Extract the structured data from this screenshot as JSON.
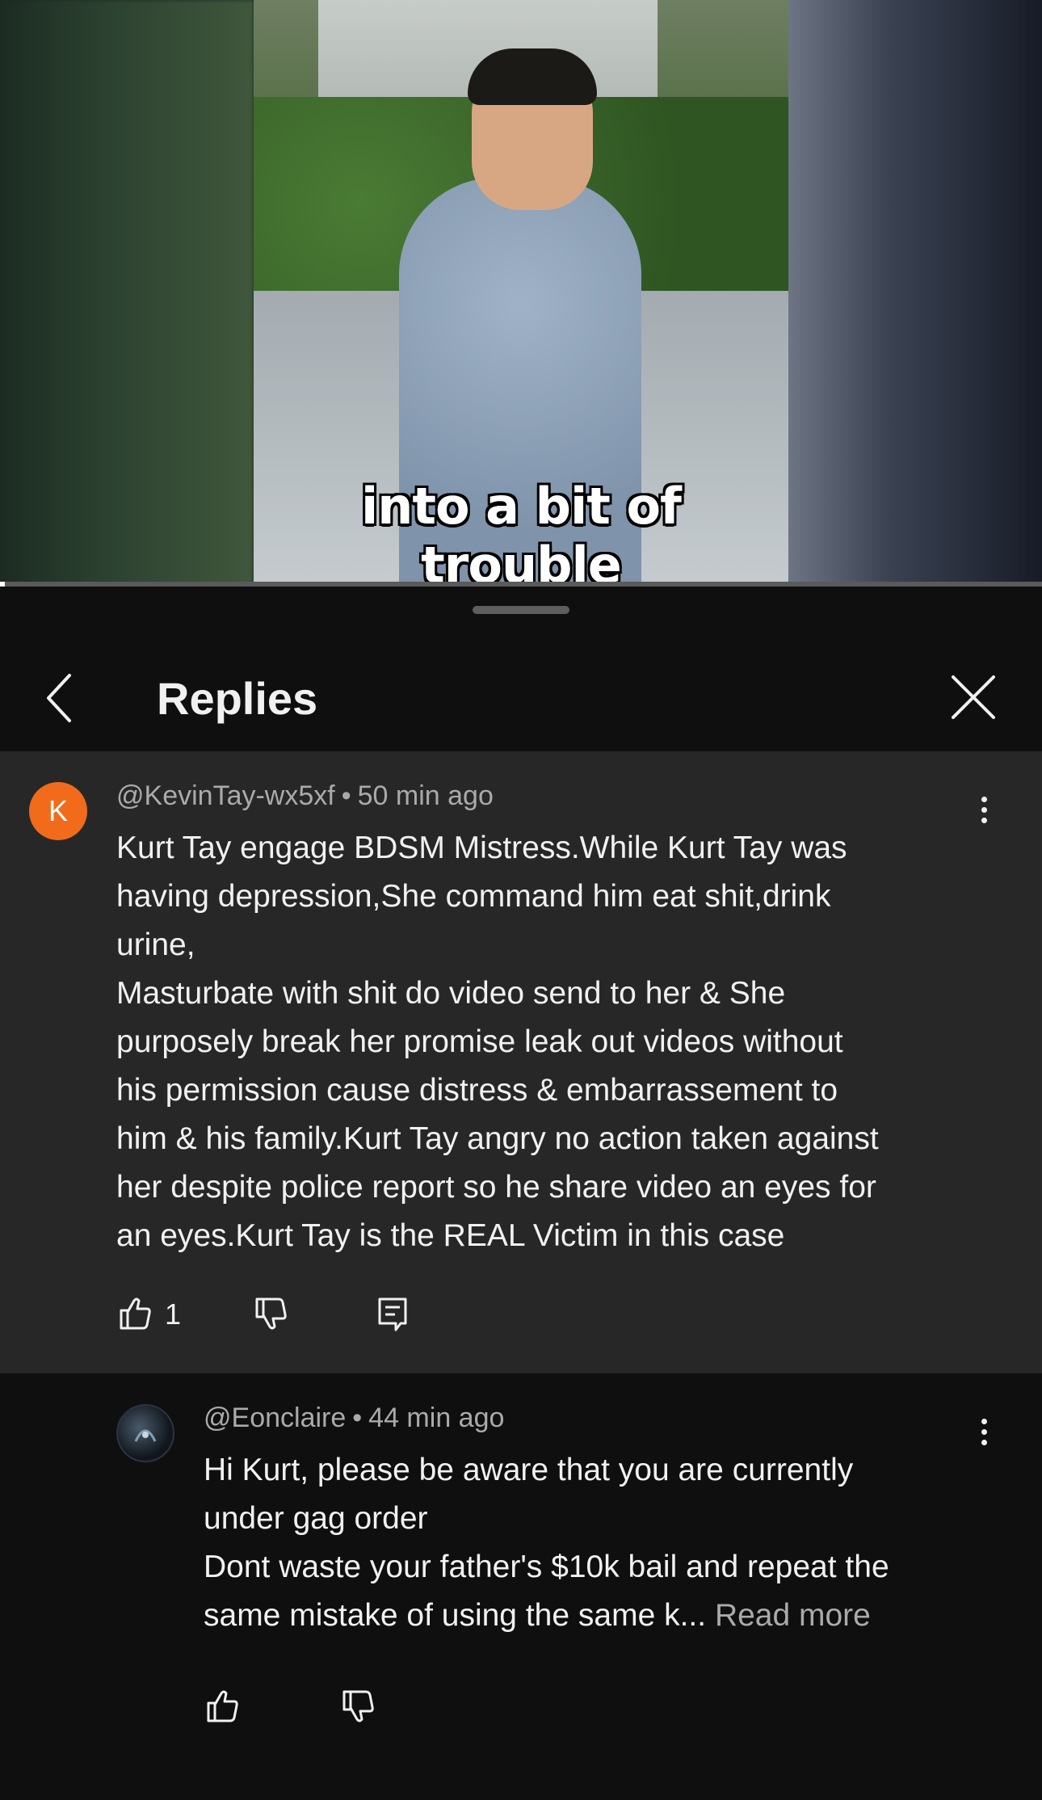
{
  "video": {
    "caption": "into a bit of trouble",
    "progress_percent": 0.5
  },
  "header": {
    "title": "Replies",
    "back_icon": "chevron-left-icon",
    "close_icon": "close-icon"
  },
  "comments": [
    {
      "avatar_letter": "K",
      "avatar_color": "#f26b1b",
      "author": "@KevinTay-wx5xf",
      "separator": "•",
      "time": "50 min ago",
      "text": "Kurt Tay engage BDSM Mistress.While Kurt Tay was\nhaving depression,She command him eat shit,drink\nurine,\nMasturbate with shit do video send to her & She\npurposely break her promise leak out videos without\nhis permission cause distress & embarrassement to\nhim & his family.Kurt Tay angry no action taken against\nher despite police report so he share video an eyes for\nan eyes.Kurt Tay is the REAL Victim in this case",
      "likes": "1"
    },
    {
      "author": "@Eonclaire",
      "separator": "•",
      "time": "44 min ago",
      "text": "Hi Kurt, please be aware that you are currently\nunder gag order\nDont waste your father's $10k bail and repeat the\nsame mistake of  using  the same k... ",
      "read_more": "Read more"
    }
  ],
  "colors": {
    "background": "#0f0f0f",
    "highlight": "#272727",
    "secondary_text": "#aaaaaa"
  }
}
